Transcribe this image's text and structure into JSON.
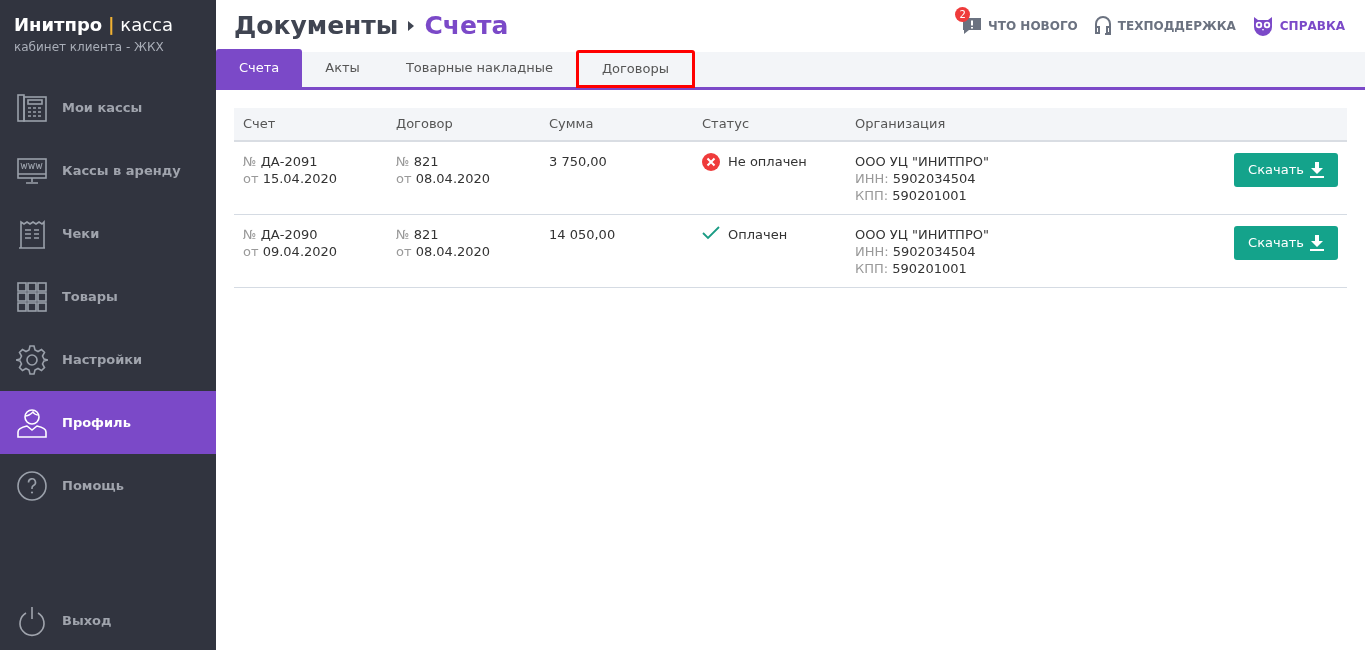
{
  "brand": {
    "name": "Инитпро",
    "separator": "|",
    "product": "касса",
    "subtitle": "кабинет клиента - ЖКХ"
  },
  "sidebar": {
    "items": [
      {
        "kind": "register",
        "label": "Мои кассы",
        "selected": false
      },
      {
        "kind": "monitor",
        "label": "Кассы в аренду",
        "selected": false
      },
      {
        "kind": "receipt",
        "label": "Чеки",
        "selected": false
      },
      {
        "kind": "grid",
        "label": "Товары",
        "selected": false
      },
      {
        "kind": "gear",
        "label": "Настройки",
        "selected": false
      },
      {
        "kind": "user",
        "label": "Профиль",
        "selected": true
      },
      {
        "kind": "help",
        "label": "Помощь",
        "selected": false
      }
    ],
    "logout": {
      "label": "Выход"
    }
  },
  "breadcrumb": [
    "Документы",
    "Счета"
  ],
  "top_links": [
    {
      "kind": "news",
      "label": "ЧТО НОВОГО",
      "badge": "2"
    },
    {
      "kind": "support",
      "label": "ТЕХПОДДЕРЖКА"
    },
    {
      "kind": "help",
      "label": "СПРАВКА"
    }
  ],
  "tabs": [
    {
      "label": "Счета",
      "selected": true,
      "highlighted": false
    },
    {
      "label": "Акты",
      "selected": false,
      "highlighted": false
    },
    {
      "label": "Товарные накладные",
      "selected": false,
      "highlighted": false
    },
    {
      "label": "Договоры",
      "selected": false,
      "highlighted": true
    }
  ],
  "table": {
    "columns": [
      "Счет",
      "Договор",
      "Сумма",
      "Статус",
      "Организация"
    ],
    "rows": [
      {
        "invoice": [
          {
            "prefix": "№",
            "value": "ДА-2091"
          },
          {
            "prefix": "от",
            "value": "15.04.2020"
          }
        ],
        "contract": [
          {
            "prefix": "№",
            "value": "821"
          },
          {
            "prefix": "от",
            "value": "08.04.2020"
          }
        ],
        "amount": "3 750,00",
        "status": {
          "kind": "unpaid",
          "label": "Не оплачен"
        },
        "org": {
          "name": "ООО УЦ \"ИНИТПРО\"",
          "lines": [
            {
              "prefix": "ИНН:",
              "value": "5902034504"
            },
            {
              "prefix": "КПП:",
              "value": "590201001"
            }
          ]
        },
        "button": "Скачать"
      },
      {
        "invoice": [
          {
            "prefix": "№",
            "value": "ДА-2090"
          },
          {
            "prefix": "от",
            "value": "09.04.2020"
          }
        ],
        "contract": [
          {
            "prefix": "№",
            "value": "821"
          },
          {
            "prefix": "от",
            "value": "08.04.2020"
          }
        ],
        "amount": "14 050,00",
        "status": {
          "kind": "paid",
          "label": "Оплачен"
        },
        "org": {
          "name": "ООО УЦ \"ИНИТПРО\"",
          "lines": [
            {
              "prefix": "ИНН:",
              "value": "5902034504"
            },
            {
              "prefix": "КПП:",
              "value": "590201001"
            }
          ]
        },
        "button": "Скачать"
      }
    ]
  }
}
